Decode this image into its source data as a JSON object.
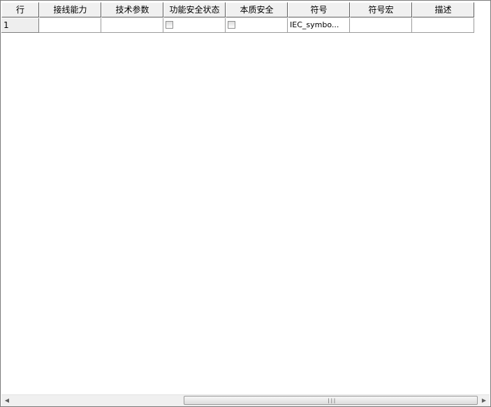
{
  "table": {
    "columns": [
      "行",
      "接线能力",
      "技术参数",
      "功能安全状态",
      "本质安全",
      "符号",
      "符号宏",
      "描述"
    ],
    "rows": [
      {
        "row_no": "1",
        "wiring_capability": "",
        "tech_params": "",
        "functional_safety": false,
        "intrinsic_safety": false,
        "symbol": "IEC_symbo...",
        "symbol_macro": "",
        "description": ""
      }
    ]
  },
  "scrollbar": {
    "left_arrow_icon": "arrow-left-icon",
    "right_arrow_icon": "arrow-right-icon",
    "grip_icon": "grip-icon",
    "left_glyph": "◀",
    "right_glyph": "▶",
    "grip_glyph": "|||"
  }
}
